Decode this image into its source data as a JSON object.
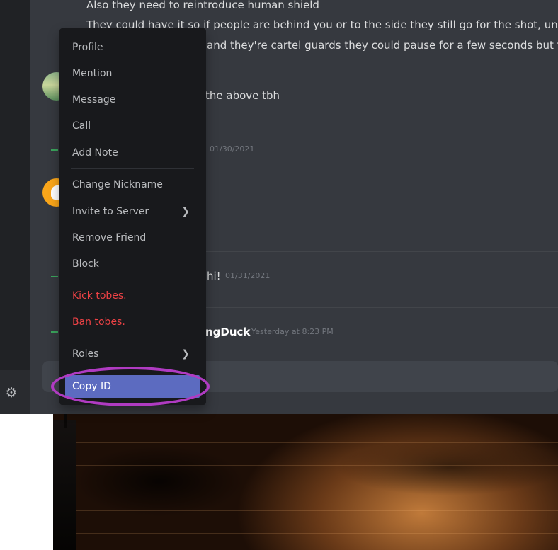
{
  "chat": {
    "lines": [
      "Also they need to reintroduce human shield",
      "They could have it so if people are behind you or to the side they still go for the shot, unless",
      "and they're cartel guards they could pause for a few seconds but the",
      "the above tbh"
    ],
    "system_messages": [
      {
        "text": "",
        "timestamp": "01/30/2021"
      },
      {
        "text": "hi!",
        "timestamp": "01/31/2021"
      },
      {
        "text": "ngDuck",
        "suffix": "!",
        "timestamp": "Yesterday at 8:23 PM"
      }
    ]
  },
  "context_menu": {
    "items": [
      {
        "label": "Profile"
      },
      {
        "label": "Mention"
      },
      {
        "label": "Message"
      },
      {
        "label": "Call"
      },
      {
        "label": "Add Note"
      },
      {
        "label": "Change Nickname"
      },
      {
        "label": "Invite to Server"
      },
      {
        "label": "Remove Friend"
      },
      {
        "label": "Block"
      },
      {
        "label": "Kick tobes."
      },
      {
        "label": "Ban tobes."
      },
      {
        "label": "Roles"
      },
      {
        "label": "Copy ID"
      }
    ]
  },
  "icons": {
    "settings": "gear-icon",
    "submenu": "chevron-right-icon"
  },
  "colors": {
    "danger": "#ed4245",
    "active": "#5c6bc0",
    "highlight": "#b03bc2",
    "system_arrow": "#3ba55d"
  }
}
